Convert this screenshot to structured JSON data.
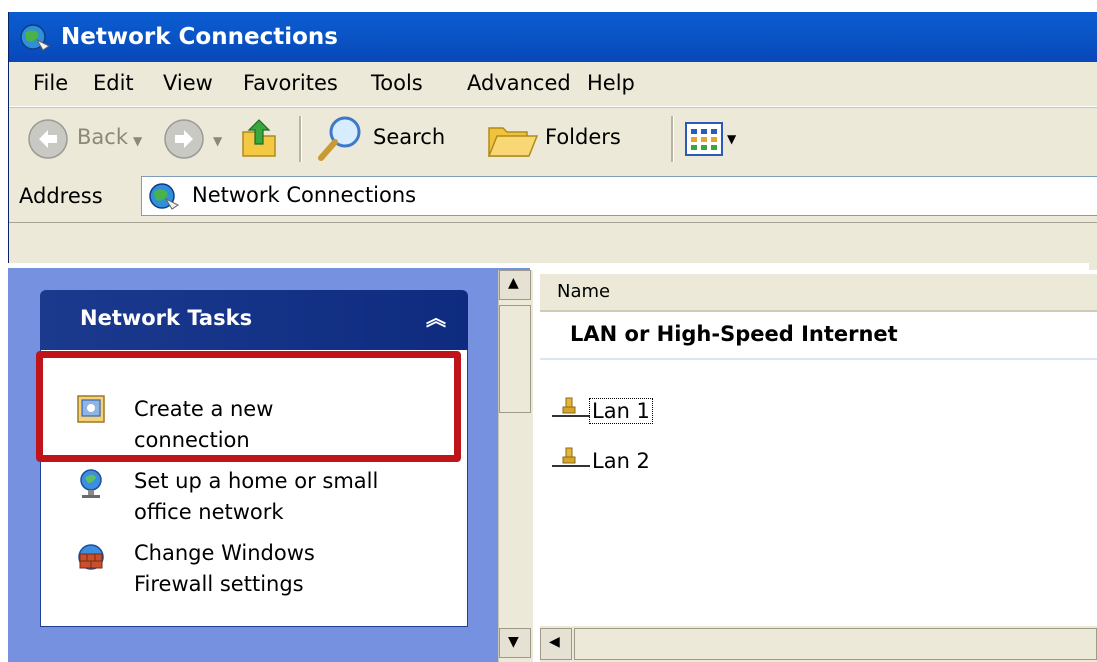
{
  "window": {
    "title": "Network Connections"
  },
  "menu": {
    "file": "File",
    "edit": "Edit",
    "view": "View",
    "favorites": "Favorites",
    "tools": "Tools",
    "advanced": "Advanced",
    "help": "Help"
  },
  "toolbar": {
    "back_label": "Back",
    "search_label": "Search",
    "folders_label": "Folders"
  },
  "address": {
    "label": "Address",
    "value": "Network Connections"
  },
  "tasks": {
    "header": "Network Tasks",
    "items": [
      {
        "line1": "Create a new",
        "line2": "connection",
        "icon": "new-connection-icon"
      },
      {
        "line1": "Set up a home or small",
        "line2": "office network",
        "icon": "home-network-icon"
      },
      {
        "line1": "Change Windows",
        "line2": "Firewall settings",
        "icon": "firewall-icon"
      }
    ]
  },
  "list": {
    "column_name": "Name",
    "group_header": "LAN or High-Speed Internet",
    "items": [
      {
        "label": "Lan 1",
        "icon": "network-cable-icon"
      },
      {
        "label": "Lan 2",
        "icon": "network-cable-icon"
      }
    ]
  },
  "colors": {
    "title_bar": "#0a56c8",
    "chrome": "#ece9d8",
    "task_header": "#0e2b80",
    "left_pane": "#7691e0",
    "highlight_box": "#c0141b"
  }
}
